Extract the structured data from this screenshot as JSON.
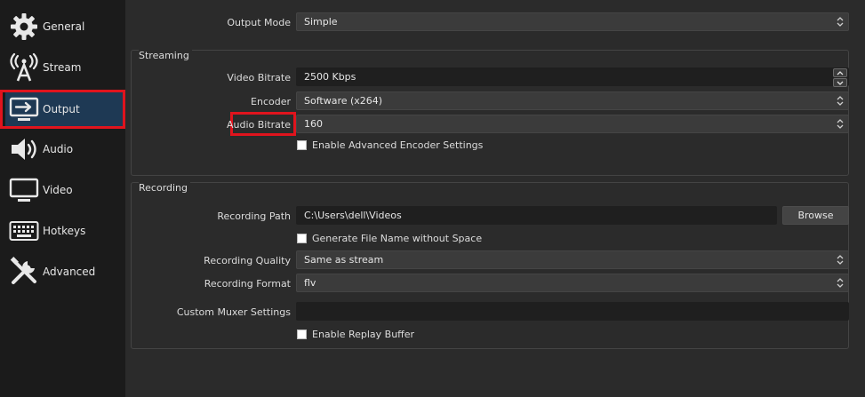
{
  "sidebar": {
    "items": [
      {
        "label": "General",
        "icon": "gear-icon"
      },
      {
        "label": "Stream",
        "icon": "broadcast-icon"
      },
      {
        "label": "Output",
        "icon": "output-monitor-icon",
        "active": true
      },
      {
        "label": "Audio",
        "icon": "speaker-icon"
      },
      {
        "label": "Video",
        "icon": "monitor-icon"
      },
      {
        "label": "Hotkeys",
        "icon": "keyboard-icon"
      },
      {
        "label": "Advanced",
        "icon": "tools-icon"
      }
    ]
  },
  "output_mode": {
    "label": "Output Mode",
    "value": "Simple"
  },
  "streaming": {
    "title": "Streaming",
    "video_bitrate": {
      "label": "Video Bitrate",
      "value": "2500 Kbps"
    },
    "encoder": {
      "label": "Encoder",
      "value": "Software (x264)"
    },
    "audio_bitrate": {
      "label": "Audio Bitrate",
      "value": "160"
    },
    "advanced_encoder": {
      "label": "Enable Advanced Encoder Settings",
      "checked": false
    }
  },
  "recording": {
    "title": "Recording",
    "path": {
      "label": "Recording Path",
      "value": "C:\\Users\\dell\\Videos"
    },
    "browse_label": "Browse",
    "no_space": {
      "label": "Generate File Name without Space",
      "checked": false
    },
    "quality": {
      "label": "Recording Quality",
      "value": "Same as stream"
    },
    "format": {
      "label": "Recording Format",
      "value": "flv"
    },
    "muxer": {
      "label": "Custom Muxer Settings",
      "value": ""
    },
    "replay_buffer": {
      "label": "Enable Replay Buffer",
      "checked": false
    }
  },
  "colors": {
    "accent_active": "#1e3954",
    "highlight": "#e0141d"
  }
}
